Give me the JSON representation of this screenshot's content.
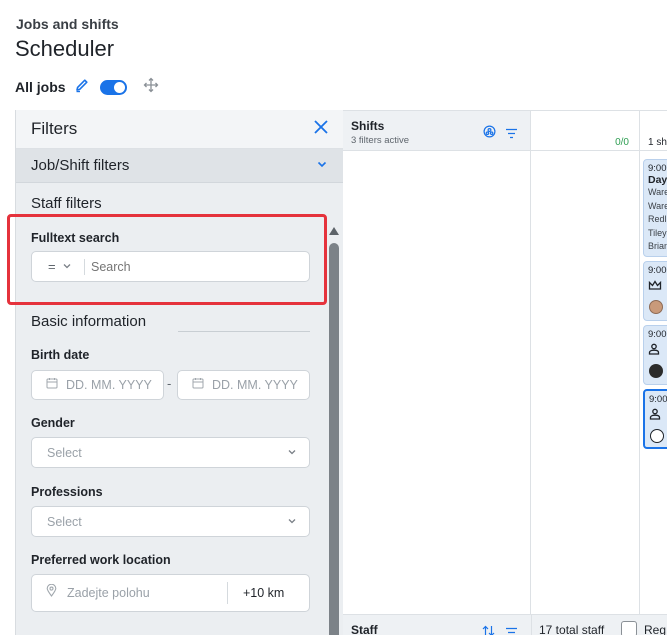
{
  "breadcrumb": "Jobs and shifts",
  "page_title": "Scheduler",
  "view": {
    "label": "All jobs",
    "toggle_on": true
  },
  "filters": {
    "title": "Filters",
    "job_shift_section": "Job/Shift filters",
    "staff_section": "Staff filters",
    "fulltext": {
      "label": "Fulltext search",
      "operator": "=",
      "placeholder": "Search"
    },
    "basic_info": "Basic information",
    "birth_date": {
      "label": "Birth date",
      "from_placeholder": "DD. MM. YYYY",
      "separator": "-",
      "to_placeholder": "DD. MM. YYYY"
    },
    "gender": {
      "label": "Gender",
      "placeholder": "Select"
    },
    "professions": {
      "label": "Professions",
      "placeholder": "Select"
    },
    "location": {
      "label": "Preferred work location",
      "placeholder": "Zadejte polohu",
      "radius": "+10 km"
    }
  },
  "grid": {
    "shifts_title": "Shifts",
    "shifts_subtitle": "3 filters active",
    "day1_count": "0/0",
    "day2_count": "1 sh",
    "cards": [
      {
        "time": "9:00",
        "name": "Day",
        "lines": [
          "Ware",
          "Ware",
          "Redl",
          "Tiley",
          "Brian"
        ]
      },
      {
        "time": "9:00",
        "icon": "crown-icon"
      },
      {
        "time": "9:00",
        "icon": "person-icon"
      },
      {
        "time": "9:00",
        "icon": "person-icon",
        "selected": true
      }
    ],
    "staff_label": "Staff",
    "total_staff": "17 total staff",
    "reg_label": "Reg"
  },
  "colors": {
    "accent": "#1a73e8",
    "highlight": "#e5323c",
    "count_green": "#2e9e52"
  }
}
